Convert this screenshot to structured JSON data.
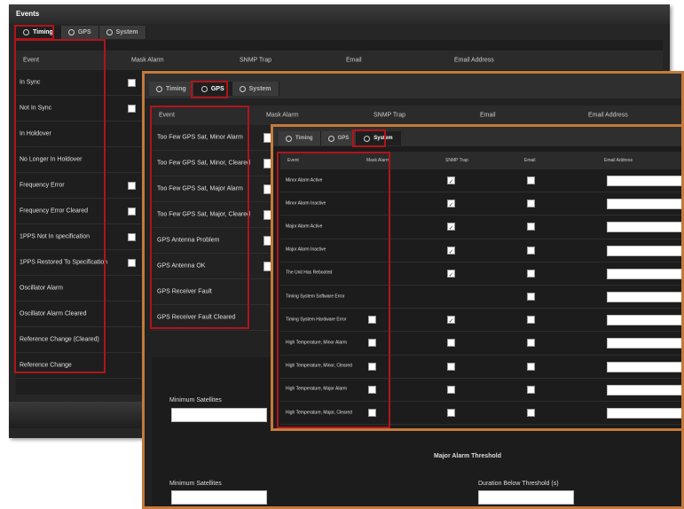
{
  "timing_panel": {
    "title": "Events",
    "tabs": [
      {
        "label": "Timing"
      },
      {
        "label": "GPS"
      },
      {
        "label": "System"
      }
    ],
    "columns": [
      "Event",
      "Mask Alarm",
      "SNMP Trap",
      "Email",
      "Email Address"
    ],
    "rows": [
      {
        "label": "In Sync"
      },
      {
        "label": "Not In Sync"
      },
      {
        "label": "In Holdover"
      },
      {
        "label": "No Longer In Holdover"
      },
      {
        "label": "Frequency Error"
      },
      {
        "label": "Frequency Error Cleared"
      },
      {
        "label": "1PPS Not In specification"
      },
      {
        "label": "1PPS Restored To Specification"
      },
      {
        "label": "Oscillator Alarm"
      },
      {
        "label": "Oscillator Alarm Cleared"
      },
      {
        "label": "Reference Change (Cleared)"
      },
      {
        "label": "Reference Change"
      }
    ]
  },
  "gps_panel": {
    "tabs": [
      {
        "label": "Timing"
      },
      {
        "label": "GPS"
      },
      {
        "label": "System"
      }
    ],
    "columns": [
      "Event",
      "Mask Alarm",
      "SNMP Trap",
      "Email",
      "Email Address"
    ],
    "rows": [
      {
        "label": "Too Few GPS Sat, Minor Alarm"
      },
      {
        "label": "Too Few GPS Sat, Minor, Cleared"
      },
      {
        "label": "Too Few GPS Sat, Major Alarm"
      },
      {
        "label": "Too Few GPS Sat, Major, Cleared"
      },
      {
        "label": "GPS Antenna Problem"
      },
      {
        "label": "GPS Antenna OK"
      },
      {
        "label": "GPS Receiver Fault"
      },
      {
        "label": "GPS Receiver Fault Cleared"
      }
    ],
    "minor_threshold": {
      "min_satellites_label": "Minimum Satellites",
      "min_satellites_value": ""
    },
    "major_threshold": {
      "title": "Major Alarm Threshold",
      "min_satellites_label": "Minimum Satellites",
      "min_satellites_value": "",
      "duration_label": "Duration Below Threshold (s)",
      "duration_value": ""
    }
  },
  "system_panel": {
    "tabs": [
      {
        "label": "Timing"
      },
      {
        "label": "GPS"
      },
      {
        "label": "System"
      }
    ],
    "columns": [
      "Event",
      "Mask Alarm",
      "SNMP Trap",
      "Email",
      "Email Address"
    ],
    "rows": [
      {
        "label": "Minor Alarm Active",
        "mask_alarm": null,
        "snmp_trap": true,
        "email": false
      },
      {
        "label": "Minor Alarm Inactive",
        "mask_alarm": null,
        "snmp_trap": true,
        "email": false
      },
      {
        "label": "Major Alarm Active",
        "mask_alarm": null,
        "snmp_trap": true,
        "email": false
      },
      {
        "label": "Major Alarm Inactive",
        "mask_alarm": null,
        "snmp_trap": true,
        "email": false
      },
      {
        "label": "The Unit Has Rebooted",
        "mask_alarm": null,
        "snmp_trap": true,
        "email": false
      },
      {
        "label": "Timing System Software Error",
        "mask_alarm": null,
        "snmp_trap": null,
        "email": false
      },
      {
        "label": "Timing System Hardware Error",
        "mask_alarm": false,
        "snmp_trap": true,
        "email": false
      },
      {
        "label": "High Temperature, Minor Alarm",
        "mask_alarm": false,
        "snmp_trap": false,
        "email": false
      },
      {
        "label": "High Temperature, Minor, Cleared",
        "mask_alarm": false,
        "snmp_trap": false,
        "email": false
      },
      {
        "label": "High Temperature, Major Alarm",
        "mask_alarm": false,
        "snmp_trap": false,
        "email": false
      },
      {
        "label": "High Temperature, Major, Cleared",
        "mask_alarm": false,
        "snmp_trap": false,
        "email": false
      }
    ]
  },
  "colors": {
    "highlight_red": "#b0141b",
    "panel_border_orange": "#c47a3c",
    "panel_dark": "#222222"
  },
  "icons": [
    "radio-dot-icon",
    "checkmark-icon"
  ]
}
